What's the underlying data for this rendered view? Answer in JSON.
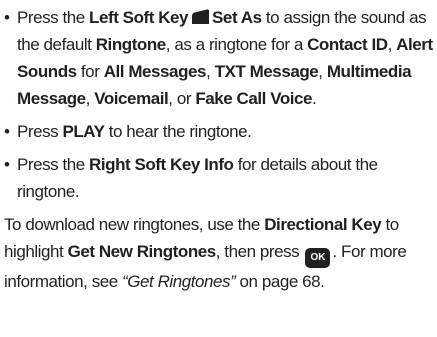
{
  "bullets": [
    {
      "segments": [
        {
          "t": "Press the ",
          "b": false
        },
        {
          "t": "Left Soft Key",
          "b": true
        },
        {
          "icon": "left-soft-key-icon"
        },
        {
          "t": "Set As",
          "b": true
        },
        {
          "t": " to assign the sound as the default ",
          "b": false
        },
        {
          "t": "Ringtone",
          "b": true
        },
        {
          "t": ", as a ringtone for a ",
          "b": false
        },
        {
          "t": "Contact ID",
          "b": true
        },
        {
          "t": ", ",
          "b": false
        },
        {
          "t": "Alert Sounds",
          "b": true
        },
        {
          "t": " for ",
          "b": false
        },
        {
          "t": "All Messages",
          "b": true
        },
        {
          "t": ", ",
          "b": false
        },
        {
          "t": "TXT Message",
          "b": true
        },
        {
          "t": ", ",
          "b": false
        },
        {
          "t": "Multimedia Message",
          "b": true
        },
        {
          "t": ", ",
          "b": false
        },
        {
          "t": "Voicemail",
          "b": true
        },
        {
          "t": ", or ",
          "b": false
        },
        {
          "t": "Fake Call Voice",
          "b": true
        },
        {
          "t": ".",
          "b": false
        }
      ]
    },
    {
      "segments": [
        {
          "t": "Press ",
          "b": false
        },
        {
          "t": "PLAY",
          "b": true
        },
        {
          "t": " to hear the ringtone.",
          "b": false
        }
      ]
    },
    {
      "segments": [
        {
          "t": "Press the ",
          "b": false
        },
        {
          "t": "Right Soft Key Info",
          "b": true
        },
        {
          "t": " for details about the ringtone.",
          "b": false
        }
      ]
    }
  ],
  "paragraph": {
    "segments": [
      {
        "t": "To download new ringtones, use the ",
        "b": false
      },
      {
        "t": "Directional Key",
        "b": true
      },
      {
        "t": " to highlight ",
        "b": false
      },
      {
        "t": "Get New Ringtones",
        "b": true
      },
      {
        "t": ", then press ",
        "b": false
      },
      {
        "ok": "OK"
      },
      {
        "t": ". For more information, see ",
        "b": false
      },
      {
        "t": "“Get Ringtones”",
        "i": true
      },
      {
        "t": " on page 68.",
        "b": false
      }
    ]
  },
  "bullet_char": "•"
}
